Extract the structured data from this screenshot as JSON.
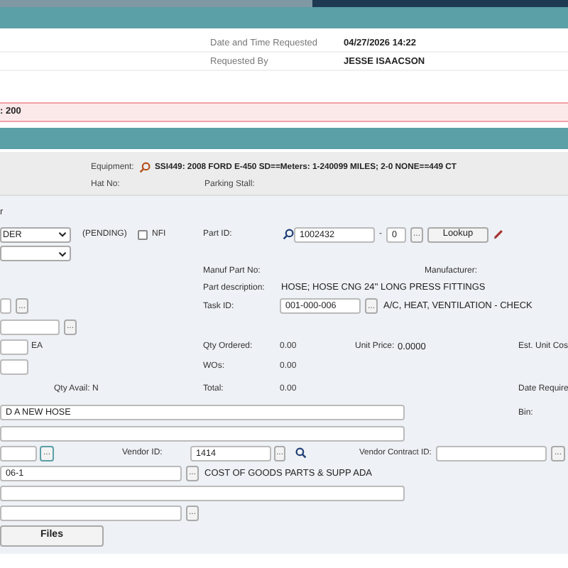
{
  "header": {
    "fields": [
      {
        "label": "Date and Time Requested",
        "value": "04/27/2026 14:22"
      },
      {
        "label": "Requested By",
        "value": "JESSE ISAACSON"
      }
    ]
  },
  "alert": {
    "text": ": 200"
  },
  "equipment": {
    "label": "Equipment:",
    "value": "SSI449: 2008 FORD E-450 SD==Meters: 1-240099 MILES; 2-0 NONE==449 CT",
    "hat_label": "Hat No:",
    "parking_label": "Parking Stall:"
  },
  "form": {
    "fragment": "r",
    "status_select": {
      "value": "DER"
    },
    "status": "(PENDING)",
    "nfi": {
      "label": "NFI",
      "checked": false
    },
    "part_id": {
      "label": "Part ID:",
      "value": "1002432",
      "separator": "-",
      "suffix": "0",
      "browse": "...",
      "lookup": "Lookup"
    },
    "manuf_part_no": {
      "label": "Manuf Part No:"
    },
    "manufacturer": {
      "label": "Manufacturer:"
    },
    "part_description": {
      "label": "Part description:",
      "value": "HOSE; HOSE CNG 24'' LONG PRESS FITTINGS"
    },
    "field_a": {
      "browse": "..."
    },
    "task_id": {
      "label": "Task ID:",
      "value": "001-000-006",
      "browse": "...",
      "description": "A/C, HEAT, VENTILATION - CHECK"
    },
    "field_b": {
      "browse": "..."
    },
    "unit": "EA",
    "qty_ordered": {
      "label": "Qty Ordered:",
      "value": "0.00"
    },
    "unit_price": {
      "label": "Unit Price:",
      "value": "0.0000"
    },
    "est_unit_cost": {
      "label": "Est. Unit Cos"
    },
    "wos": {
      "label": "WOs:",
      "value": "0.00"
    },
    "qty_avail": {
      "label": "Qty Avail:",
      "value": "N"
    },
    "total": {
      "label": "Total:",
      "value": "0.00"
    },
    "date_required": {
      "label": "Date Require"
    },
    "notes": {
      "value": "D A NEW HOSE"
    },
    "bin": {
      "label": "Bin:"
    },
    "field_c": {
      "browse": "..."
    },
    "vendor_id": {
      "label": "Vendor ID:",
      "value": "1414",
      "browse": "..."
    },
    "vendor_contract_id": {
      "label": "Vendor Contract ID:",
      "browse": "..."
    },
    "account": {
      "value": "06-1",
      "browse": "...",
      "description": "COST OF GOODS PARTS & SUPP ADA"
    },
    "field_d": {
      "browse": "..."
    },
    "files_button": "Files"
  }
}
